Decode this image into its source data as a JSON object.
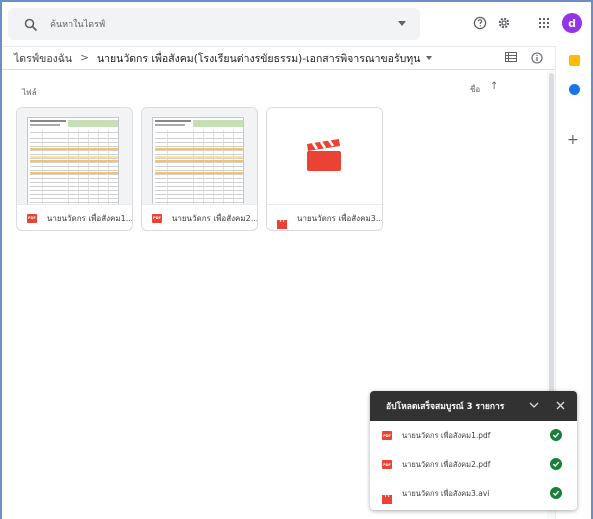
{
  "search": {
    "placeholder": "ค้นหาในไดรฟ์"
  },
  "header_icons": [
    "help-icon",
    "settings-icon",
    "apps-grid-icon"
  ],
  "account": {
    "initial": "d",
    "color": "#9334e6"
  },
  "breadcrumb": {
    "root": "ไดรฟ์ของฉัน",
    "separator": ">",
    "current": "นายนวัดกร เพื่อสังคม(โรงเรียนต่างรขัยธรรม)-เอกสารพิจารณาขอรับทุน"
  },
  "content": {
    "section_label": "ไฟล์",
    "sort_label": "ชื่อ",
    "sort_arrow": "↑"
  },
  "files": [
    {
      "name": "นายนวัดกร เพื่อสังคม1...",
      "type": "pdf",
      "badge": "PDF"
    },
    {
      "name": "นายนวัดกร เพื่อสังคม2...",
      "type": "pdf",
      "badge": "PDF"
    },
    {
      "name": "นายนวัดกร เพื่อสังคม3...",
      "type": "video"
    }
  ],
  "upload_panel": {
    "title": "อัปโหลดเสร็จสมบูรณ์ 3 รายการ",
    "items": [
      {
        "name": "นายนวัดกร เพื่อสังคม1.pdf",
        "type": "pdf",
        "badge": "PDF"
      },
      {
        "name": "นายนวัดกร เพื่อสังคม2.pdf",
        "type": "pdf",
        "badge": "PDF"
      },
      {
        "name": "นายนวัดกร เพื่อสังคม3.avi",
        "type": "video"
      }
    ]
  },
  "colors": {
    "pdf_red": "#ea4335",
    "success_green": "#188038",
    "panel_header": "#323232",
    "keep_yellow": "#fbbc04",
    "tasks_blue": "#1a73e8"
  }
}
